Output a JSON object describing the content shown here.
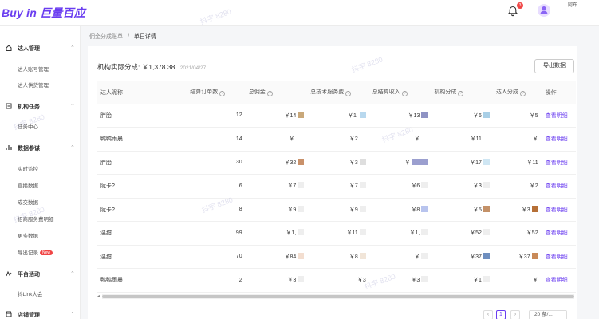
{
  "header": {
    "logo": "Buy in 巨量百应",
    "notification_count": "3",
    "user_name": "阿布"
  },
  "sidebar": {
    "groups": [
      {
        "label": "达人管理",
        "icon": "home-icon",
        "items": [
          "达人账号管理",
          "达人供货管理"
        ]
      },
      {
        "label": "机构任务",
        "icon": "task-icon",
        "items": [
          "任务中心"
        ]
      },
      {
        "label": "数据参谋",
        "icon": "data-icon",
        "items": [
          "实时监控",
          "直播数据",
          "成交数据",
          "招商服务费明细",
          "更多数据",
          "导出记录"
        ]
      },
      {
        "label": "平台活动",
        "icon": "activity-icon",
        "items": [
          "抖Link大会"
        ]
      },
      {
        "label": "店铺管理",
        "icon": "store-icon",
        "items": []
      }
    ],
    "new_badge": "New"
  },
  "breadcrumb": {
    "parent": "佣金分成账单",
    "separator": "/",
    "current": "单日详情"
  },
  "summary": {
    "label": "机构实际分成:",
    "amount": "￥1,378.38",
    "date": "2021/04/27"
  },
  "export_button": "导出数据",
  "table": {
    "headers": [
      "达人昵称",
      "结算订单数",
      "总佣金",
      "总技术服务费",
      "总结算收入",
      "机构分成",
      "达人分成",
      "操作"
    ],
    "rows": [
      {
        "name": "胖胎",
        "orders": "12",
        "commission": "￥14",
        "service_fee": "￥1 ",
        "income": "￥13",
        "org_share": "￥6",
        "talent_share": "￥5",
        "action": "查看明细"
      },
      {
        "name": "鸭鸭雨晨",
        "orders": "14",
        "commission": "￥.",
        "service_fee": "￥2",
        "income": "￥",
        "org_share": "￥11",
        "talent_share": "￥",
        "action": "查看明细"
      },
      {
        "name": "胖胎",
        "orders": "30",
        "commission": "￥32",
        "service_fee": "￥3",
        "income": "￥",
        "org_share": "￥17",
        "talent_share": "￥11",
        "action": "查看明细"
      },
      {
        "name": "阮卡?",
        "orders": "6",
        "commission": "￥7",
        "service_fee": "￥7",
        "income": "￥6",
        "org_share": "￥3",
        "talent_share": "￥2",
        "action": "查看明细"
      },
      {
        "name": "阮卡?",
        "orders": "8",
        "commission": "￥9",
        "service_fee": "￥9",
        "income": "￥8",
        "org_share": "￥5",
        "talent_share": "￥3",
        "action": "查看明细"
      },
      {
        "name": "温甜",
        "orders": "99",
        "commission": "￥1,",
        "service_fee": "￥11",
        "income": "￥1,",
        "org_share": "￥52",
        "talent_share": "￥52",
        "action": "查看明细"
      },
      {
        "name": "温甜",
        "orders": "70",
        "commission": "￥84",
        "service_fee": "￥8",
        "income": "￥",
        "org_share": "￥37",
        "talent_share": "￥37",
        "action": "查看明细"
      },
      {
        "name": "鸭鸭雨晨",
        "orders": "2",
        "commission": "￥3",
        "service_fee": "￥3",
        "income": "￥3",
        "org_share": "￥1",
        "talent_share": "￥",
        "action": "查看明细"
      }
    ]
  },
  "pagination": {
    "current": "1",
    "page_size": "20 条/..."
  },
  "watermark": "抖宇 8280",
  "colors": {
    "accent": "#6a3df0",
    "badge": "#f04545"
  }
}
